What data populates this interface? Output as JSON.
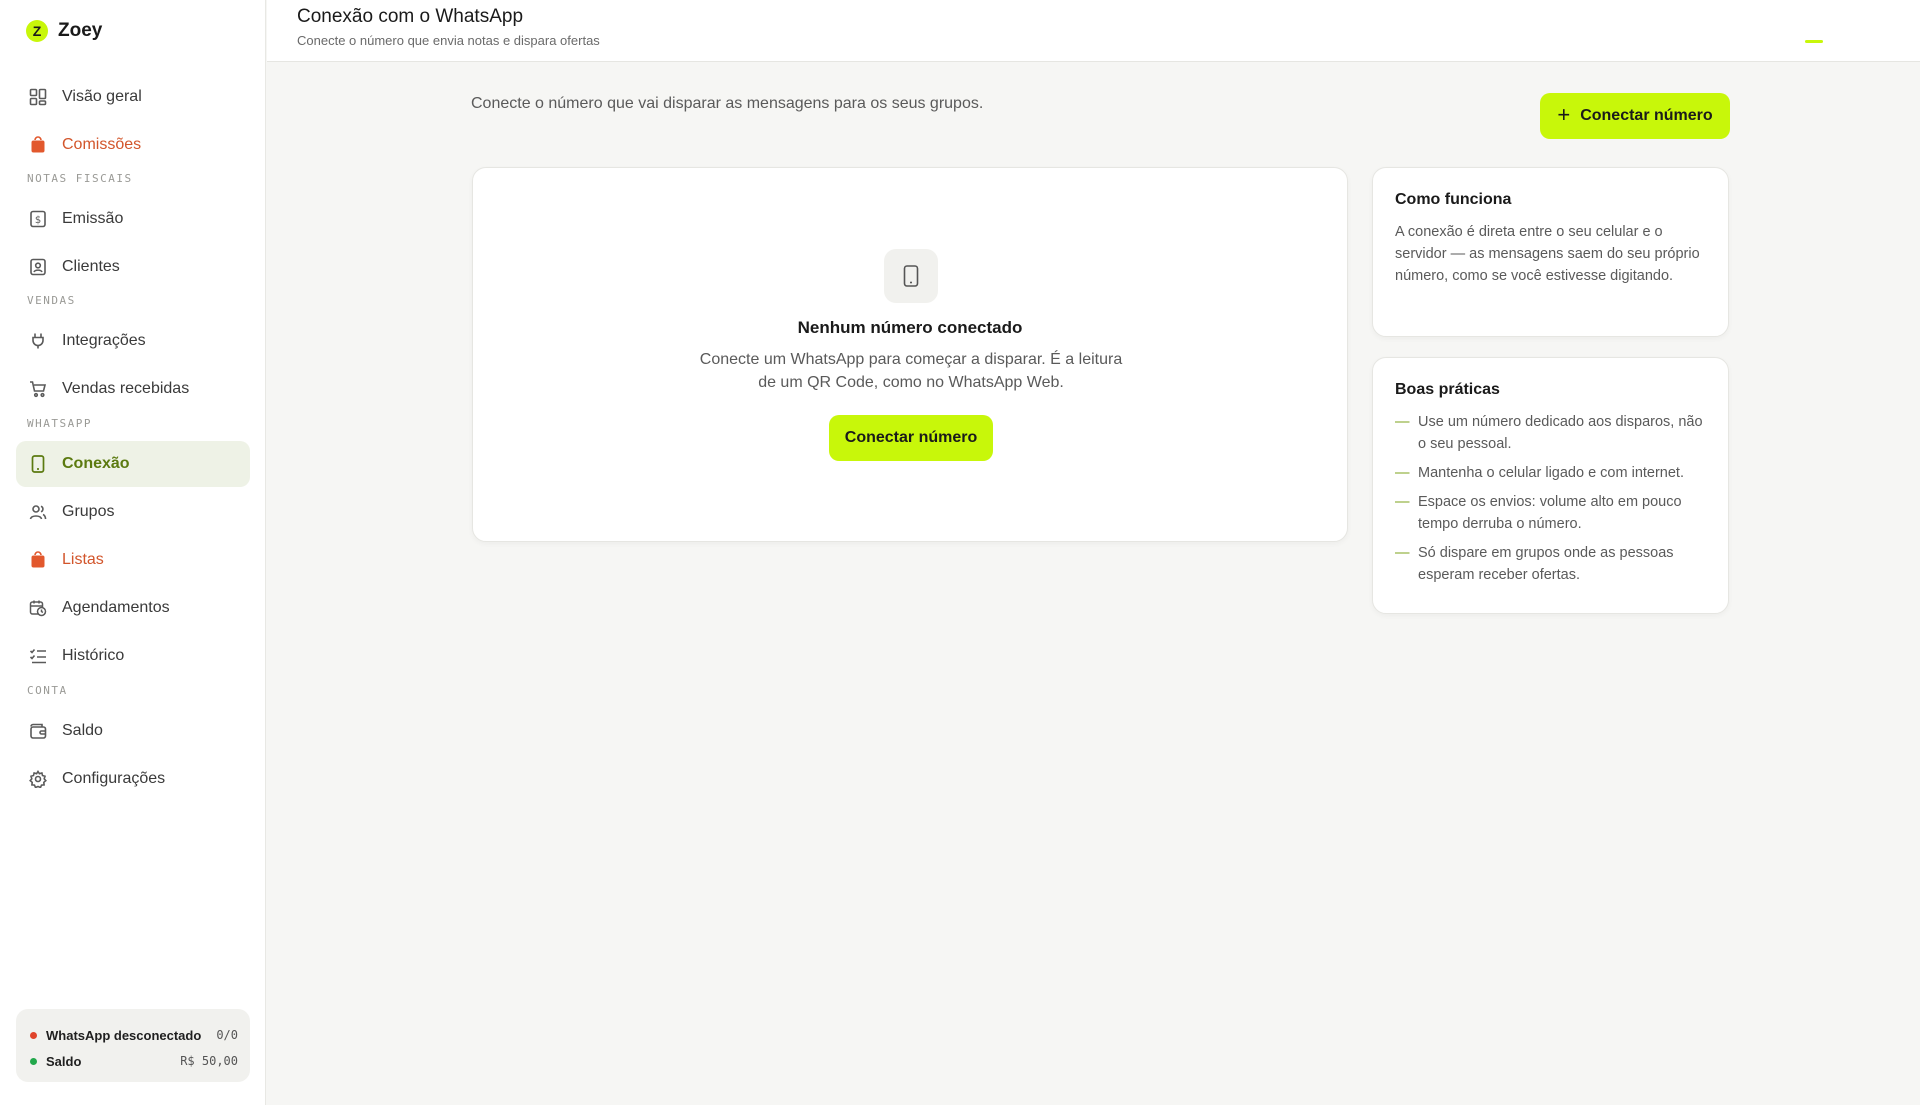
{
  "brand": {
    "logo_letter": "Z",
    "name": "Zoey"
  },
  "sidebar": {
    "items": [
      {
        "label": "Visão geral",
        "icon": "grid-icon"
      },
      {
        "label": "Comissões",
        "icon": "bag-icon"
      },
      {
        "label": "Emissão",
        "icon": "receipt-icon"
      },
      {
        "label": "Clientes",
        "icon": "contact-icon"
      },
      {
        "label": "Integrações",
        "icon": "plug-icon"
      },
      {
        "label": "Vendas recebidas",
        "icon": "cart-icon"
      },
      {
        "label": "Conexão",
        "icon": "phone-icon"
      },
      {
        "label": "Grupos",
        "icon": "users-icon"
      },
      {
        "label": "Listas",
        "icon": "bag-icon"
      },
      {
        "label": "Agendamentos",
        "icon": "calendar-clock-icon"
      },
      {
        "label": "Histórico",
        "icon": "list-check-icon"
      },
      {
        "label": "Saldo",
        "icon": "wallet-icon"
      },
      {
        "label": "Configurações",
        "icon": "gear-icon"
      }
    ],
    "sections": [
      "NOTAS FISCAIS",
      "VENDAS",
      "WHATSAPP",
      "CONTA"
    ],
    "status": {
      "whatsapp_label": "WhatsApp desconectado",
      "whatsapp_value": "0/0",
      "whatsapp_color": "#e0442b",
      "saldo_label": "Saldo",
      "saldo_value": "R$ 50,00",
      "saldo_color": "#22a84b"
    }
  },
  "header": {
    "title": "Conexão com o WhatsApp",
    "subtitle": "Conecte o número que envia notas e dispara ofertas"
  },
  "main": {
    "intro": "Conecte o número que vai disparar as mensagens para os seus grupos.",
    "connect_button": "Conectar número",
    "empty": {
      "title": "Nenhum número conectado",
      "description": "Conecte um WhatsApp para começar a disparar. É a leitura de um QR Code, como no WhatsApp Web.",
      "button": "Conectar número"
    },
    "how_it_works": {
      "title": "Como funciona",
      "text": "A conexão é direta entre o seu celular e o servidor — as mensagens saem do seu próprio número, como se você estivesse digitando."
    },
    "best_practices": {
      "title": "Boas práticas",
      "tips": [
        "Use um número dedicado aos disparos, não o seu pessoal.",
        "Mantenha o celular ligado e com internet.",
        "Espace os envios: volume alto em pouco tempo derruba o número.",
        "Só dispare em grupos onde as pessoas esperam receber ofertas."
      ]
    }
  },
  "colors": {
    "accent": "#c8f70a",
    "active_text": "#5b7a10",
    "warning": "#d2552b"
  }
}
